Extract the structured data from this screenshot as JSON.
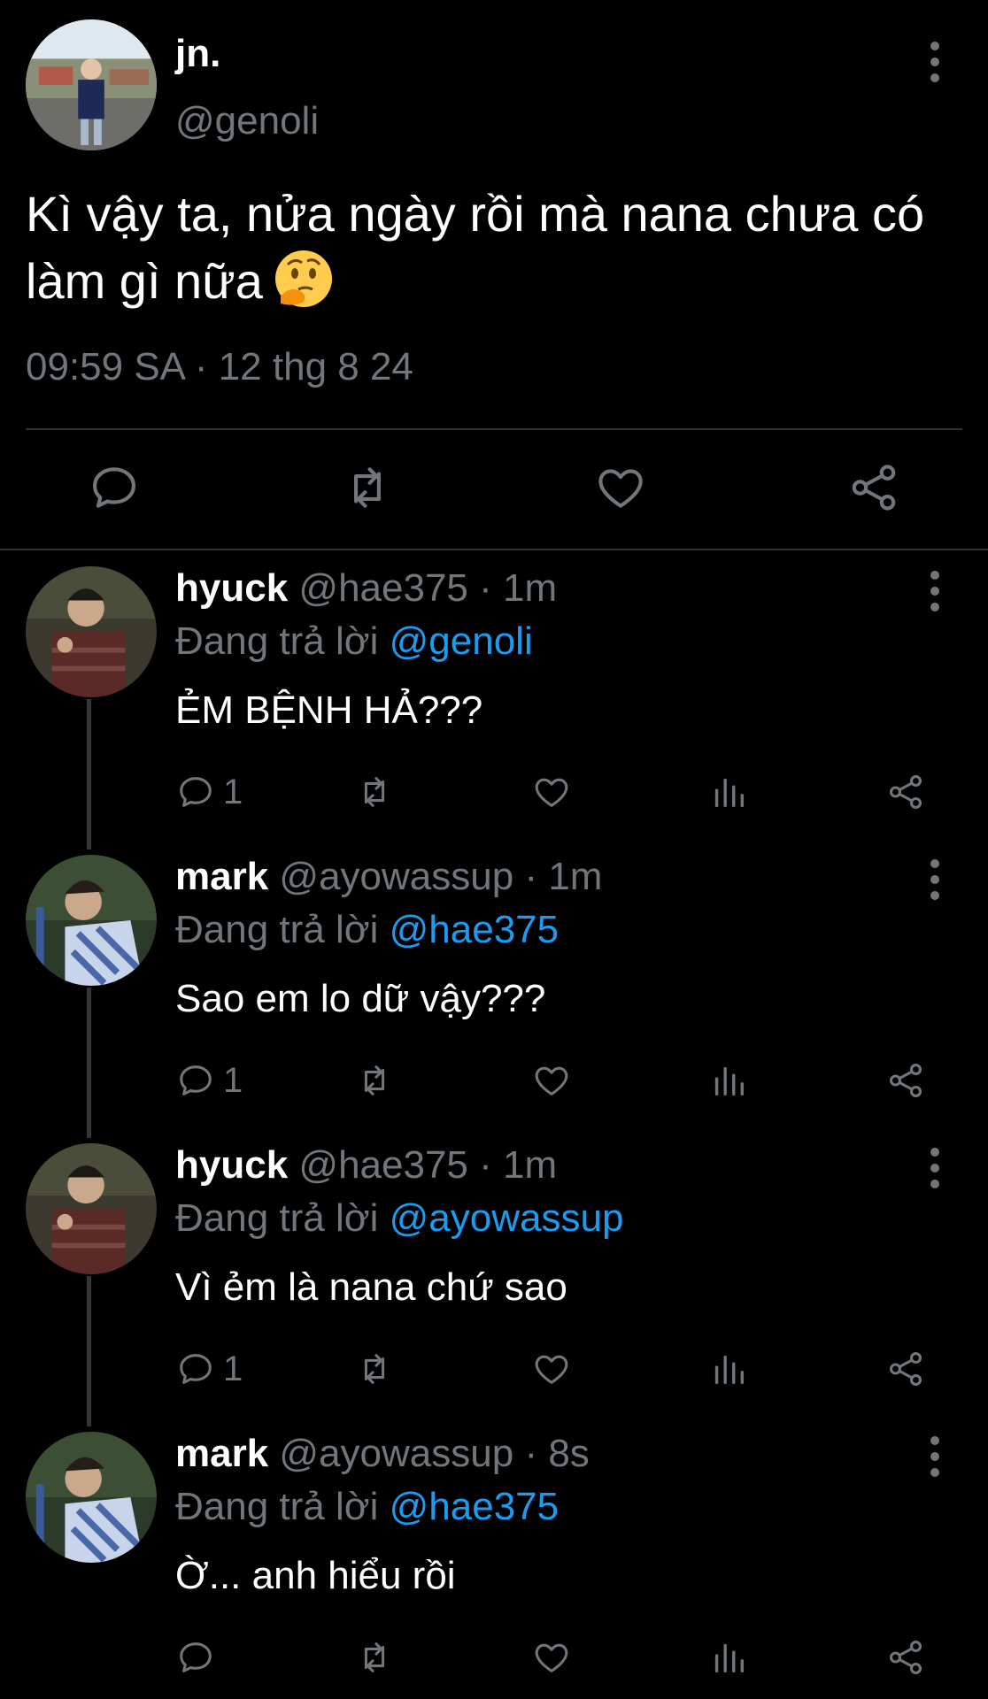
{
  "main_tweet": {
    "author_name": "jn.",
    "author_handle": "@genoli",
    "text": "Kì vậy ta, nửa ngày rồi mà nana chưa có làm gì nữa",
    "emoji": "thinking-face-emoji",
    "timestamp": "09:59 SA · 12 thg 8 24",
    "actions": [
      "reply-icon",
      "retweet-icon",
      "like-icon",
      "share-icon"
    ]
  },
  "replies": [
    {
      "name": "hyuck",
      "meta": "@hae375 · 1m",
      "reply_prefix": "Đang trả lời",
      "reply_to": "@genoli",
      "text": "ẺM BỆNH HẢ???",
      "reply_count": "1"
    },
    {
      "name": "mark",
      "meta": "@ayowassup · 1m",
      "reply_prefix": "Đang trả lời",
      "reply_to": "@hae375",
      "text": "Sao em lo dữ vậy???",
      "reply_count": "1"
    },
    {
      "name": "hyuck",
      "meta": "@hae375 · 1m",
      "reply_prefix": "Đang trả lời",
      "reply_to": "@ayowassup",
      "text": "Vì ẻm là nana chứ sao",
      "reply_count": "1"
    },
    {
      "name": "mark",
      "meta": "@ayowassup · 8s",
      "reply_prefix": "Đang trả lời",
      "reply_to": "@hae375",
      "text": "Ờ... anh hiểu rồi",
      "reply_count": ""
    }
  ],
  "colors": {
    "background": "#000000",
    "text": "#ffffff",
    "muted": "#71767b",
    "mention": "#1d9bf0",
    "divider": "#2f3336"
  }
}
